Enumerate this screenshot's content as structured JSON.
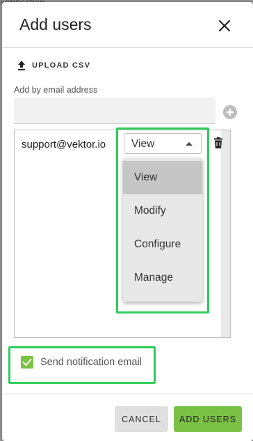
{
  "backdrop": {
    "text": "NOTIFICATION"
  },
  "dialog": {
    "title": "Add users",
    "upload_label": "UPLOAD CSV",
    "email_label": "Add by email address",
    "email_value": "",
    "email_placeholder": ""
  },
  "users": [
    {
      "email": "support@vektor.io",
      "permission": "View"
    }
  ],
  "permission_menu": {
    "options": [
      "View",
      "Modify",
      "Configure",
      "Manage"
    ],
    "selected": "View"
  },
  "notification": {
    "label": "Send notification email",
    "checked": true
  },
  "actions": {
    "cancel_label": "CANCEL",
    "add_label": "ADD USERS"
  },
  "colors": {
    "accent": "#7bc145",
    "highlight": "#2ecc58"
  }
}
